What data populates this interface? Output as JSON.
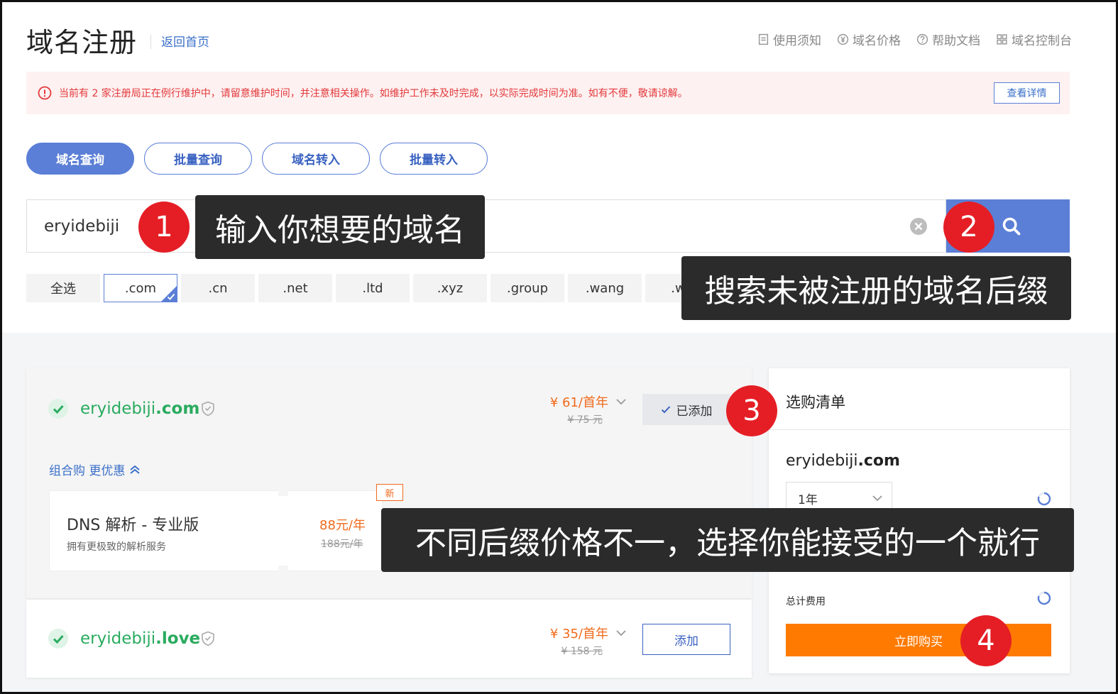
{
  "header": {
    "title": "域名注册",
    "back_link": "返回首页",
    "nav": [
      {
        "label": "使用须知",
        "icon": "document-icon"
      },
      {
        "label": "域名价格",
        "icon": "yen-icon"
      },
      {
        "label": "帮助文档",
        "icon": "help-icon"
      },
      {
        "label": "域名控制台",
        "icon": "grid-icon"
      }
    ]
  },
  "notice": {
    "text": "当前有 2 家注册局正在例行维护中，请留意维护时间，并注意相关操作。如维护工作未及时完成，以实际完成时间为准。如有不便，敬请谅解。",
    "detail_button": "查看详情"
  },
  "tabs": [
    {
      "label": "域名查询",
      "active": true
    },
    {
      "label": "批量查询",
      "active": false
    },
    {
      "label": "域名转入",
      "active": false
    },
    {
      "label": "批量转入",
      "active": false
    }
  ],
  "search": {
    "value": "eryidebiji"
  },
  "suffixes": [
    {
      "label": "全选",
      "selected": false
    },
    {
      "label": ".com",
      "selected": true
    },
    {
      "label": ".cn",
      "selected": false
    },
    {
      "label": ".net",
      "selected": false
    },
    {
      "label": ".ltd",
      "selected": false
    },
    {
      "label": ".xyz",
      "selected": false
    },
    {
      "label": ".group",
      "selected": false
    },
    {
      "label": ".wang",
      "selected": false
    },
    {
      "label": ".wo",
      "selected": false
    }
  ],
  "results": [
    {
      "name": "eryidebiji",
      "tld": ".com",
      "price": "¥ 61/首年",
      "orig_price": "¥ 75 元",
      "action": "已添加"
    },
    {
      "name": "eryidebiji",
      "tld": ".love",
      "price": "¥ 35/首年",
      "orig_price": "¥ 158 元",
      "action": "添加"
    }
  ],
  "combo": {
    "link": "组合购 更优惠",
    "badge": "新",
    "title": "DNS 解析 - 专业版",
    "desc": "拥有更极致的解析服务",
    "price": "88元/年",
    "orig_price": "188元/年"
  },
  "cart": {
    "title": "选购清单",
    "domain_name": "eryidebiji",
    "domain_tld": ".com",
    "period": "1年",
    "total_label": "总计费用",
    "buy_button": "立即购买"
  },
  "annotations": {
    "step1": {
      "num": "1",
      "text": "输入你想要的域名"
    },
    "step2": {
      "num": "2",
      "text": "搜索未被注册的域名后缀"
    },
    "step3": {
      "num": "3"
    },
    "step4": {
      "num": "4"
    },
    "note": "不同后缀价格不一，选择你能接受的一个就行"
  },
  "colors": {
    "primary": "#5b7fd6",
    "success": "#2aab5f",
    "price": "#f06a1c",
    "buy": "#ff7a00",
    "marker": "#e51e25"
  }
}
